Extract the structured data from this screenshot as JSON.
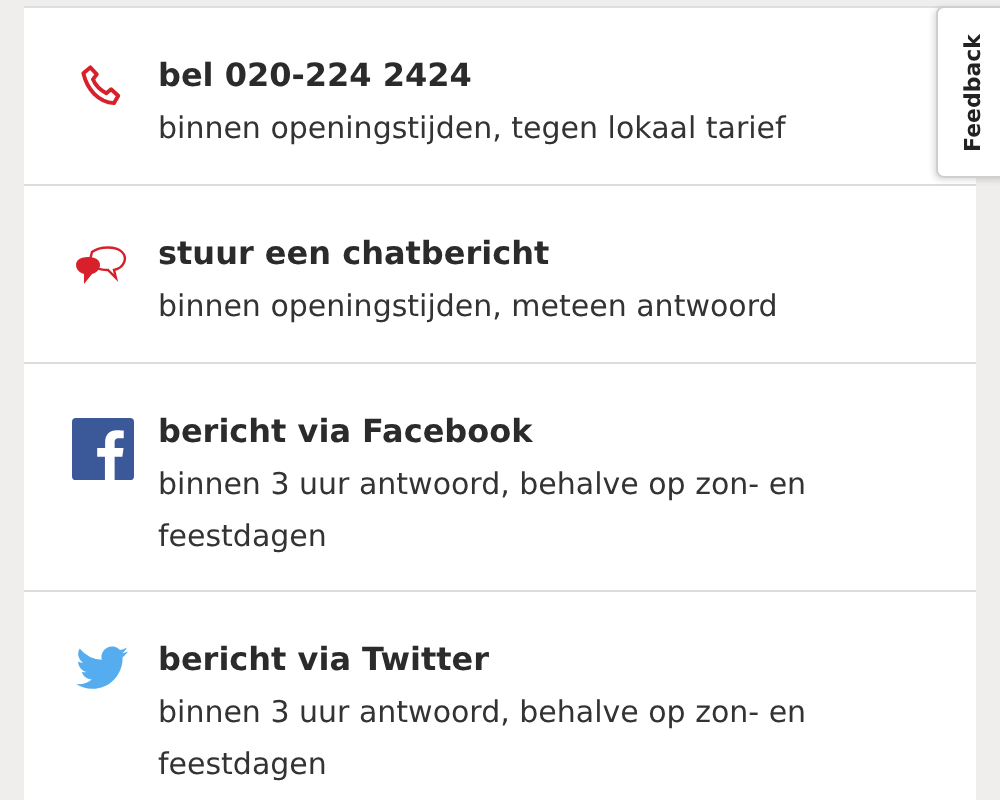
{
  "contact_options": [
    {
      "kind": "phone",
      "title": "bel 020-224 2424",
      "subtitle": "binnen openingstijden, tegen lokaal tarief"
    },
    {
      "kind": "chat",
      "title": "stuur een chatbericht",
      "subtitle": "binnen openingstijden, meteen antwoord"
    },
    {
      "kind": "facebook",
      "title": "bericht via Facebook",
      "subtitle": "binnen 3 uur antwoord, behalve op zon- en feestdagen"
    },
    {
      "kind": "twitter",
      "title": "bericht via Twitter",
      "subtitle": "binnen 3 uur antwoord, behalve op zon- en feestdagen"
    }
  ],
  "feedback_tab": {
    "label": "Feedback"
  }
}
